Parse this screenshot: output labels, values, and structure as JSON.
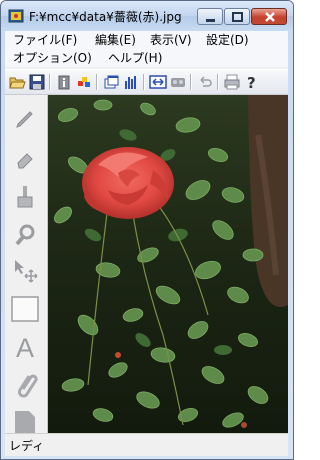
{
  "window": {
    "title": "F:¥mcc¥data¥薔薇(赤).jpg"
  },
  "menu": {
    "row1": [
      {
        "label": "ファイル(F)",
        "id": "file"
      },
      {
        "label": "編集(E)",
        "id": "edit"
      },
      {
        "label": "表示(V)",
        "id": "view"
      },
      {
        "label": "設定(D)",
        "id": "settings"
      }
    ],
    "row2": [
      {
        "label": "オプション(O)",
        "id": "options"
      },
      {
        "label": "ヘルプ(H)",
        "id": "help"
      }
    ]
  },
  "toolbar": {
    "buttons": [
      "open-folder-icon",
      "save-icon",
      "info-icon",
      "color-icon",
      "window-icon",
      "histogram-icon",
      "fit-width-icon",
      "slideshow-icon",
      "undo-icon",
      "print-icon",
      "help-icon"
    ]
  },
  "sidebar": {
    "tools": [
      "pencil-icon",
      "eraser-icon",
      "brush-icon",
      "magnifier-icon",
      "move-select-icon",
      "rectangle-icon",
      "text-icon",
      "clip-icon",
      "page-icon"
    ],
    "text_tool_letter": "A"
  },
  "status": {
    "text": "レディ"
  },
  "colors": {
    "accent": "#c24a34",
    "rose": "#e8504a"
  }
}
